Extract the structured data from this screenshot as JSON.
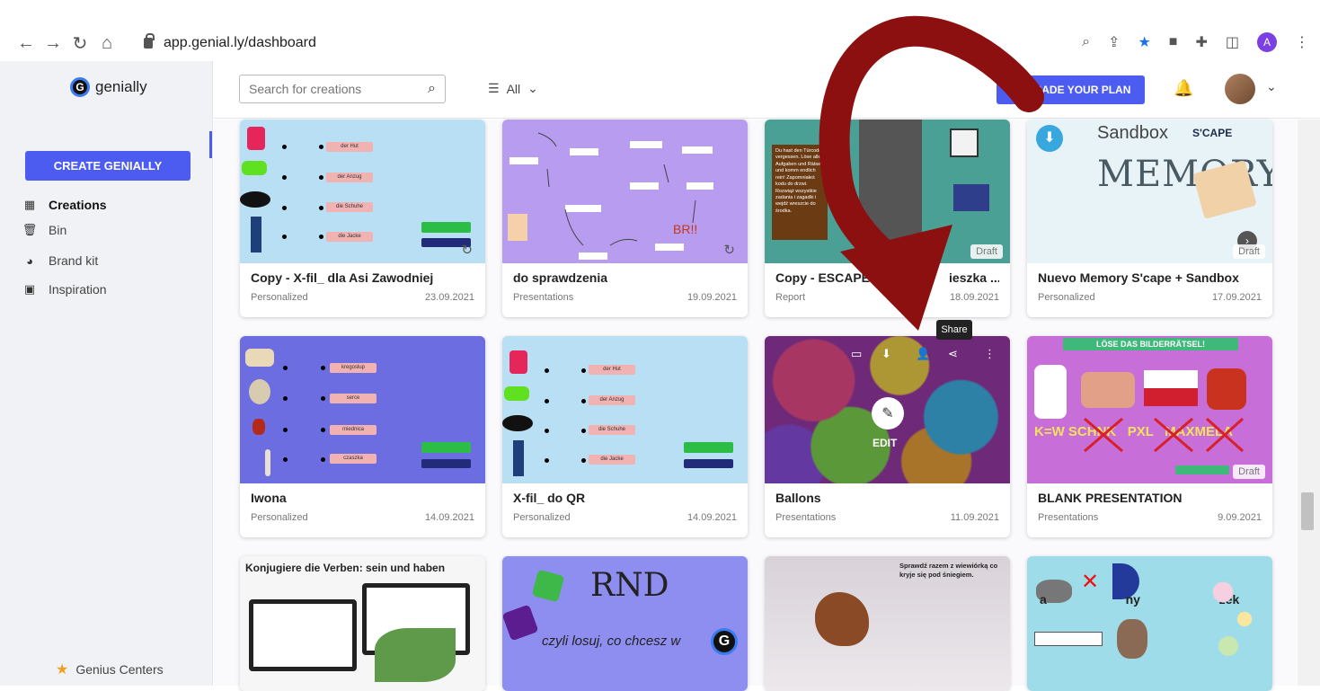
{
  "browser": {
    "url": "app.genial.ly/dashboard",
    "profile_initial": "A"
  },
  "sidebar": {
    "logo": "genially",
    "create_label": "CREATE GENIALLY",
    "items": [
      {
        "label": "Creations",
        "icon": "grid-icon"
      },
      {
        "label": "Bin",
        "icon": "trash-icon"
      },
      {
        "label": "Brand kit",
        "icon": "palette-icon"
      },
      {
        "label": "Inspiration",
        "icon": "inspiration-icon"
      }
    ],
    "footer": "Genius Centers"
  },
  "topbar": {
    "search_placeholder": "Search for creations",
    "filter_label": "All",
    "upgrade_label": "UPGRADE YOUR PLAN"
  },
  "cards": [
    {
      "title": "Copy - X-fil_ dla Asi Zawodniej",
      "type": "Personalized",
      "date": "23.09.2021"
    },
    {
      "title": "do sprawdzenia",
      "type": "Presentations",
      "date": "19.09.2021"
    },
    {
      "title": "Copy - ESCAPE",
      "title_tail": "ieszka ...",
      "type": "Report",
      "date": "18.09.2021",
      "status": "Draft"
    },
    {
      "title": "Nuevo Memory S'cape + Sandbox",
      "type": "Personalized",
      "date": "17.09.2021",
      "status": "Draft"
    },
    {
      "title": "Iwona",
      "type": "Personalized",
      "date": "14.09.2021"
    },
    {
      "title": "X-fil_ do QR",
      "type": "Personalized",
      "date": "14.09.2021"
    },
    {
      "title": "Ballons",
      "type": "Presentations",
      "date": "11.09.2021"
    },
    {
      "title": "BLANK PRESENTATION",
      "type": "Presentations",
      "date": "9.09.2021",
      "status": "Draft"
    }
  ],
  "hover": {
    "edit_label": "EDIT",
    "tooltip": "Share"
  },
  "thumb_text": {
    "german_words": [
      "der Hut",
      "der Anzug",
      "die Schuhe",
      "die Jacke"
    ],
    "polish_words": [
      "kregosłup",
      "serce",
      "miednica",
      "czaszka"
    ],
    "escape_text": "Du hast den Türcode vergessen. Löse alle Aufgaben und Rätsel und komm endlich rein! Zapomniałeś kodu do drzwi. Rozwiąż wszystkie zadania i zagadki i wejdź wreszcie do środka.",
    "memory_brand": "Sandbox",
    "memory_title": "MEMORY",
    "memory_tag": "S'CAPE",
    "blank_banner": "LÖSE DAS BILDERRÄTSEL!",
    "blank_words": "K=W SCHNK   PXL   MAXMELA",
    "konj_title": "Konjugiere die Verben: sein und haben",
    "rnd_title": "RND",
    "rnd_sub": "czyli losuj, co chcesz w",
    "squirrel_text": "Sprawdź razem z wiewiórką co kryje się pod śniegiem.",
    "easter_letters": "a  ny  zek"
  }
}
